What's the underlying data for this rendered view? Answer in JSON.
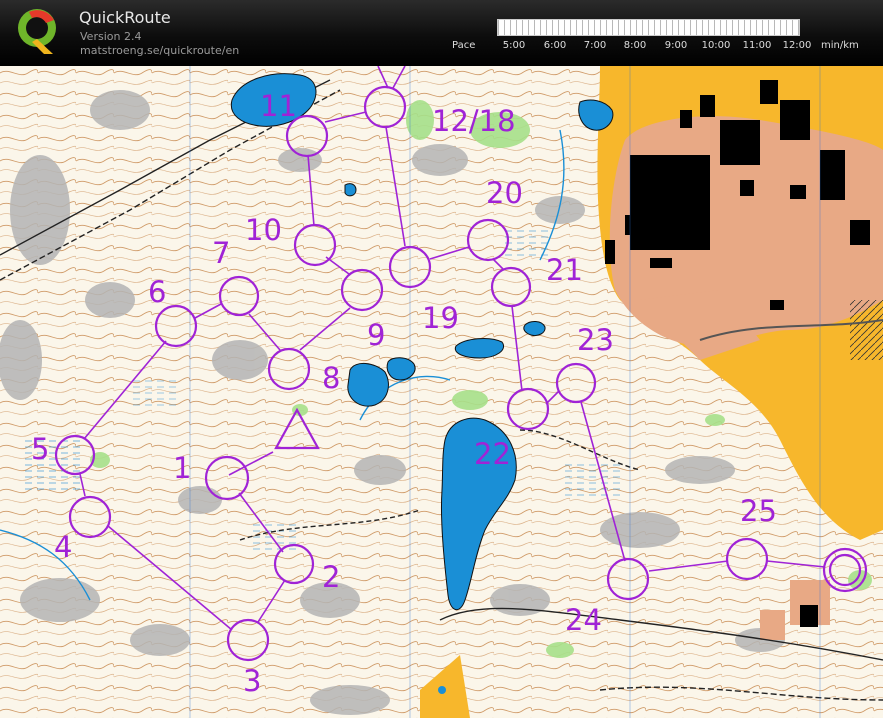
{
  "app": {
    "title": "QuickRoute",
    "version": "Version 2.4",
    "url": "matstroeng.se/quickroute/en",
    "logo_icon": "quickroute-q-logo"
  },
  "pace": {
    "label": "Pace",
    "ticks": [
      "5:00",
      "6:00",
      "7:00",
      "8:00",
      "9:00",
      "10:00",
      "11:00",
      "12:00"
    ],
    "unit": "min/km"
  },
  "colors": {
    "course": "#a023d6",
    "water": "#1a8fd6",
    "urban": "#e8a985",
    "open_land": "#f7b72c",
    "contours": "#b96b2c",
    "rock": "#b4b4b4"
  },
  "course": {
    "start_label": "Start",
    "labels": [
      "1",
      "2",
      "3",
      "4",
      "5",
      "6",
      "7",
      "8",
      "9",
      "10",
      "11",
      "12/18",
      "19",
      "20",
      "21",
      "22",
      "23",
      "24",
      "25"
    ]
  }
}
